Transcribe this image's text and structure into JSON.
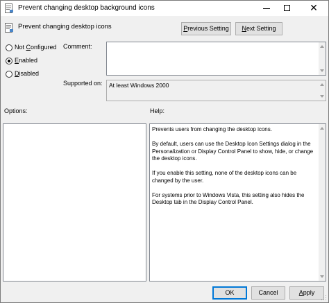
{
  "window": {
    "title": "Prevent changing desktop background icons",
    "caption_buttons": {
      "minimize": "minimize-icon",
      "maximize": "maximize-icon",
      "close": "✕"
    }
  },
  "header": {
    "title": "Prevent changing desktop icons",
    "icon": "policy-setting-icon"
  },
  "navigation": {
    "previous": {
      "accel": "P",
      "rest": "revious Setting"
    },
    "next": {
      "accel": "N",
      "rest": "ext Setting"
    }
  },
  "state": {
    "options": [
      {
        "accel": "C",
        "pre": "Not ",
        "post": "onfigured",
        "selected": false
      },
      {
        "accel": "E",
        "pre": "",
        "post": "nabled",
        "selected": true
      },
      {
        "accel": "D",
        "pre": "",
        "post": "isabled",
        "selected": false
      }
    ]
  },
  "comment": {
    "label": "Comment:",
    "value": ""
  },
  "supported_on": {
    "label": "Supported on:",
    "value": "At least Windows 2000"
  },
  "options_panel": {
    "label": "Options:"
  },
  "help_panel": {
    "label": "Help:",
    "paragraphs": [
      "Prevents users from changing the desktop icons.",
      "By default, users can use the Desktop Icon Settings dialog in the Personalization or Display Control Panel to show, hide, or change the desktop icons.",
      "If you enable this setting, none of the desktop icons can be changed by the user.",
      "For systems prior to Windows Vista, this setting also hides the Desktop tab in the Display Control Panel."
    ]
  },
  "footer": {
    "ok": "OK",
    "cancel": "Cancel",
    "apply": {
      "accel": "A",
      "rest": "pply"
    }
  },
  "colors": {
    "focus_border": "#0078d7",
    "window_bg": "#f0f0f0",
    "button_bg": "#e1e1e1"
  }
}
